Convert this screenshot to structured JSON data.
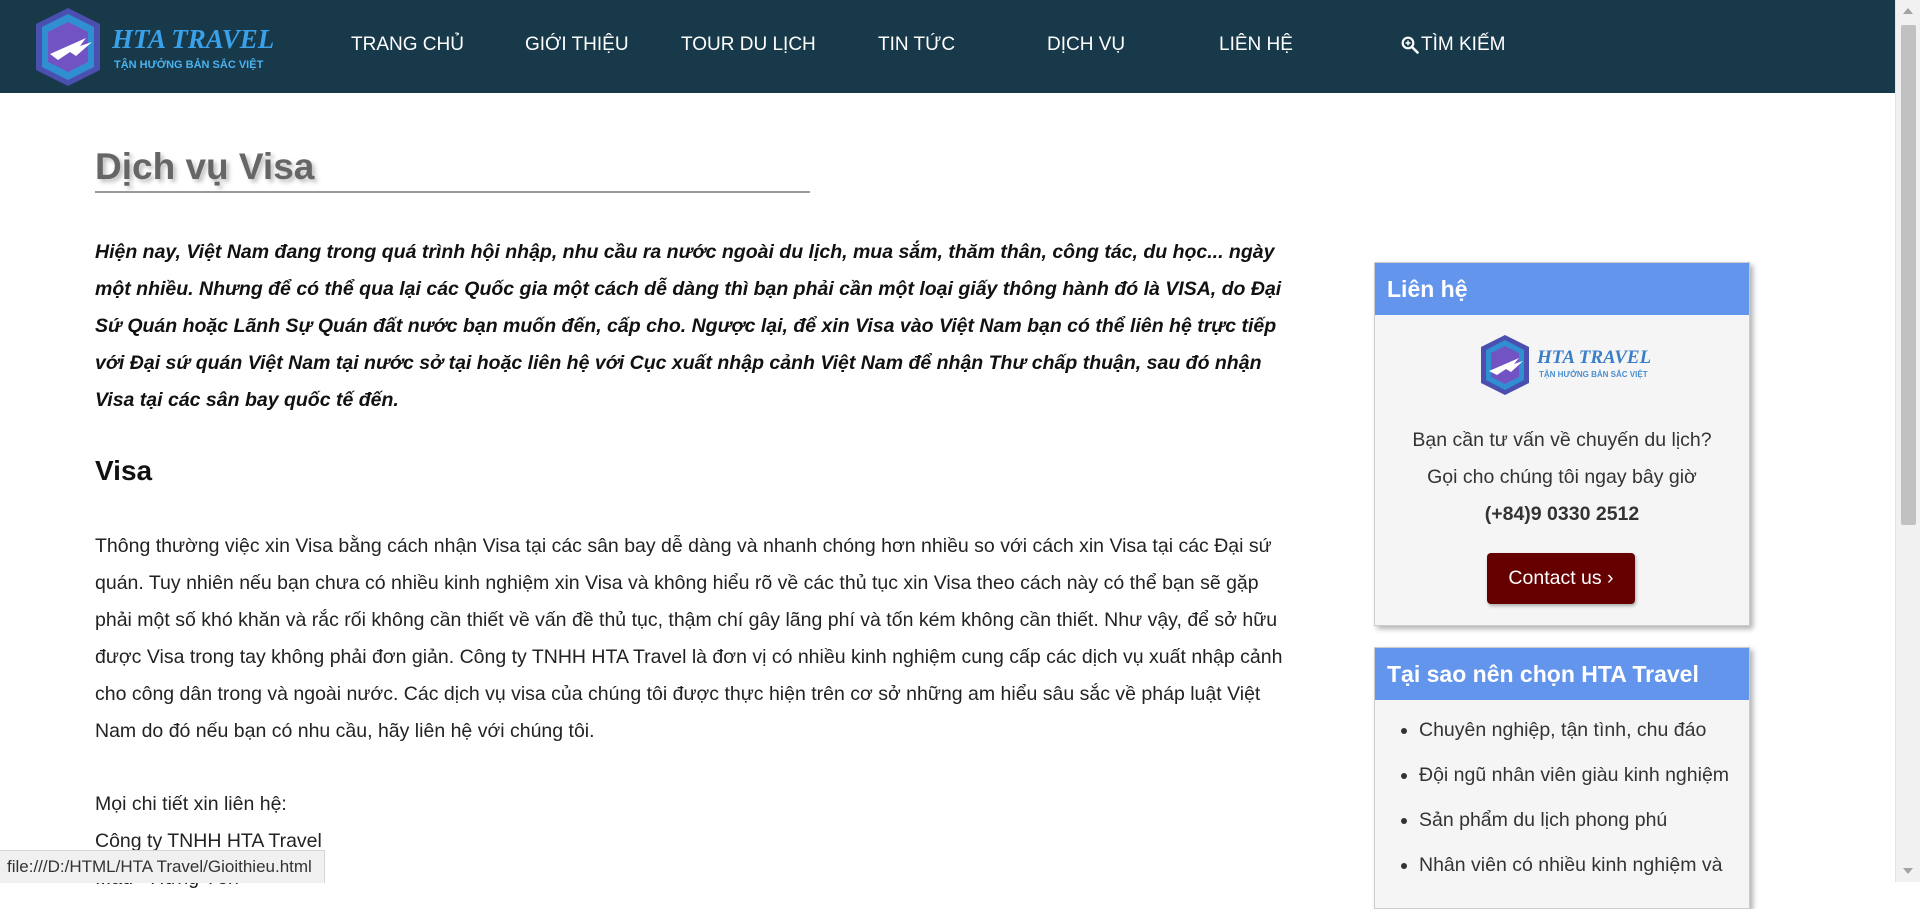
{
  "header": {
    "logo_text": "HTA TRAVEL",
    "logo_tagline": "TẬN HƯỞNG BẢN SẮC VIỆT",
    "nav": [
      {
        "label": "TRANG CHỦ"
      },
      {
        "label": "GIỚI THIỆU"
      },
      {
        "label": "TOUR DU LỊCH"
      },
      {
        "label": "TIN TỨC"
      },
      {
        "label": "DỊCH VỤ"
      },
      {
        "label": "LIÊN HỆ"
      }
    ],
    "search_label": "TÌM KIẾM"
  },
  "main": {
    "title": "Dịch vụ Visa",
    "intro": "Hiện nay, Việt Nam đang trong quá trình hội nhập, nhu cầu ra nước ngoài du lịch, mua sắm, thăm thân, công tác, du học... ngày một nhiều. Nhưng để có thể qua lại các Quốc gia một cách dễ dàng thì bạn phải cần một loại giấy thông hành đó là VISA, do Đại Sứ Quán hoặc Lãnh Sự Quán đất nước bạn muốn đến, cấp cho. Ngược lại, để xin Visa vào Việt Nam bạn có thể liên hệ trực tiếp với Đại sứ quán Việt Nam tại nước sở tại hoặc liên hệ với Cục xuất nhập cảnh Việt Nam để nhận Thư chấp thuận, sau đó nhận Visa tại các sân bay quốc tế đến.",
    "section_heading": "Visa",
    "body": "Thông thường việc xin Visa bằng cách nhận Visa tại các sân bay dễ dàng và nhanh chóng hơn nhiều so với cách xin Visa tại các Đại sứ quán. Tuy nhiên nếu bạn chưa có nhiều kinh nghiệm xin Visa và không hiểu rõ về các thủ tục xin Visa theo cách này có thể bạn sẽ gặp phải một số khó khăn và rắc rối không cần thiết về vấn đề thủ tục, thậm chí gây lãng phí và tốn kém không cần thiết. Như vậy, để sở hữu được Visa trong tay không phải đơn giản. Công ty TNHH HTA Travel là đơn vị có nhiều kinh nghiệm cung cấp các dịch vụ xuất nhập cảnh cho công dân trong và ngoài nước. Các dịch vụ visa của chúng tôi được thực hiện trên cơ sở những am hiểu sâu sắc về pháp luật Việt Nam do đó nếu bạn có nhu cầu, hãy liên hệ với chúng tôi.",
    "contact_intro": "Mọi chi tiết xin liên hệ:",
    "company": "Công ty TNHH HTA Travel",
    "address_partial": "...ầu - Hưng Yên"
  },
  "sidebar": {
    "contact": {
      "title": "Liên hệ",
      "question": "Bạn cần tư vấn về chuyến du lịch?",
      "call_text": "Gọi cho chúng tôi ngay bây giờ",
      "phone": "(+84)9 0330 2512",
      "button_label": "Contact us ›"
    },
    "why": {
      "title": "Tại sao nên chọn HTA Travel",
      "items": [
        "Chuyên nghiệp, tận tình, chu đáo",
        "Đội ngũ nhân viên giàu kinh nghiệm",
        "Sản phẩm du lịch phong phú",
        "Nhân viên có nhiều kinh nghiệm và"
      ]
    }
  },
  "status_bar": {
    "url": "file:///D:/HTML/HTA Travel/Gioithieu.html"
  },
  "colors": {
    "header_bg": "#17394a",
    "sidebar_head": "#6495ed",
    "button_bg": "#660000"
  }
}
